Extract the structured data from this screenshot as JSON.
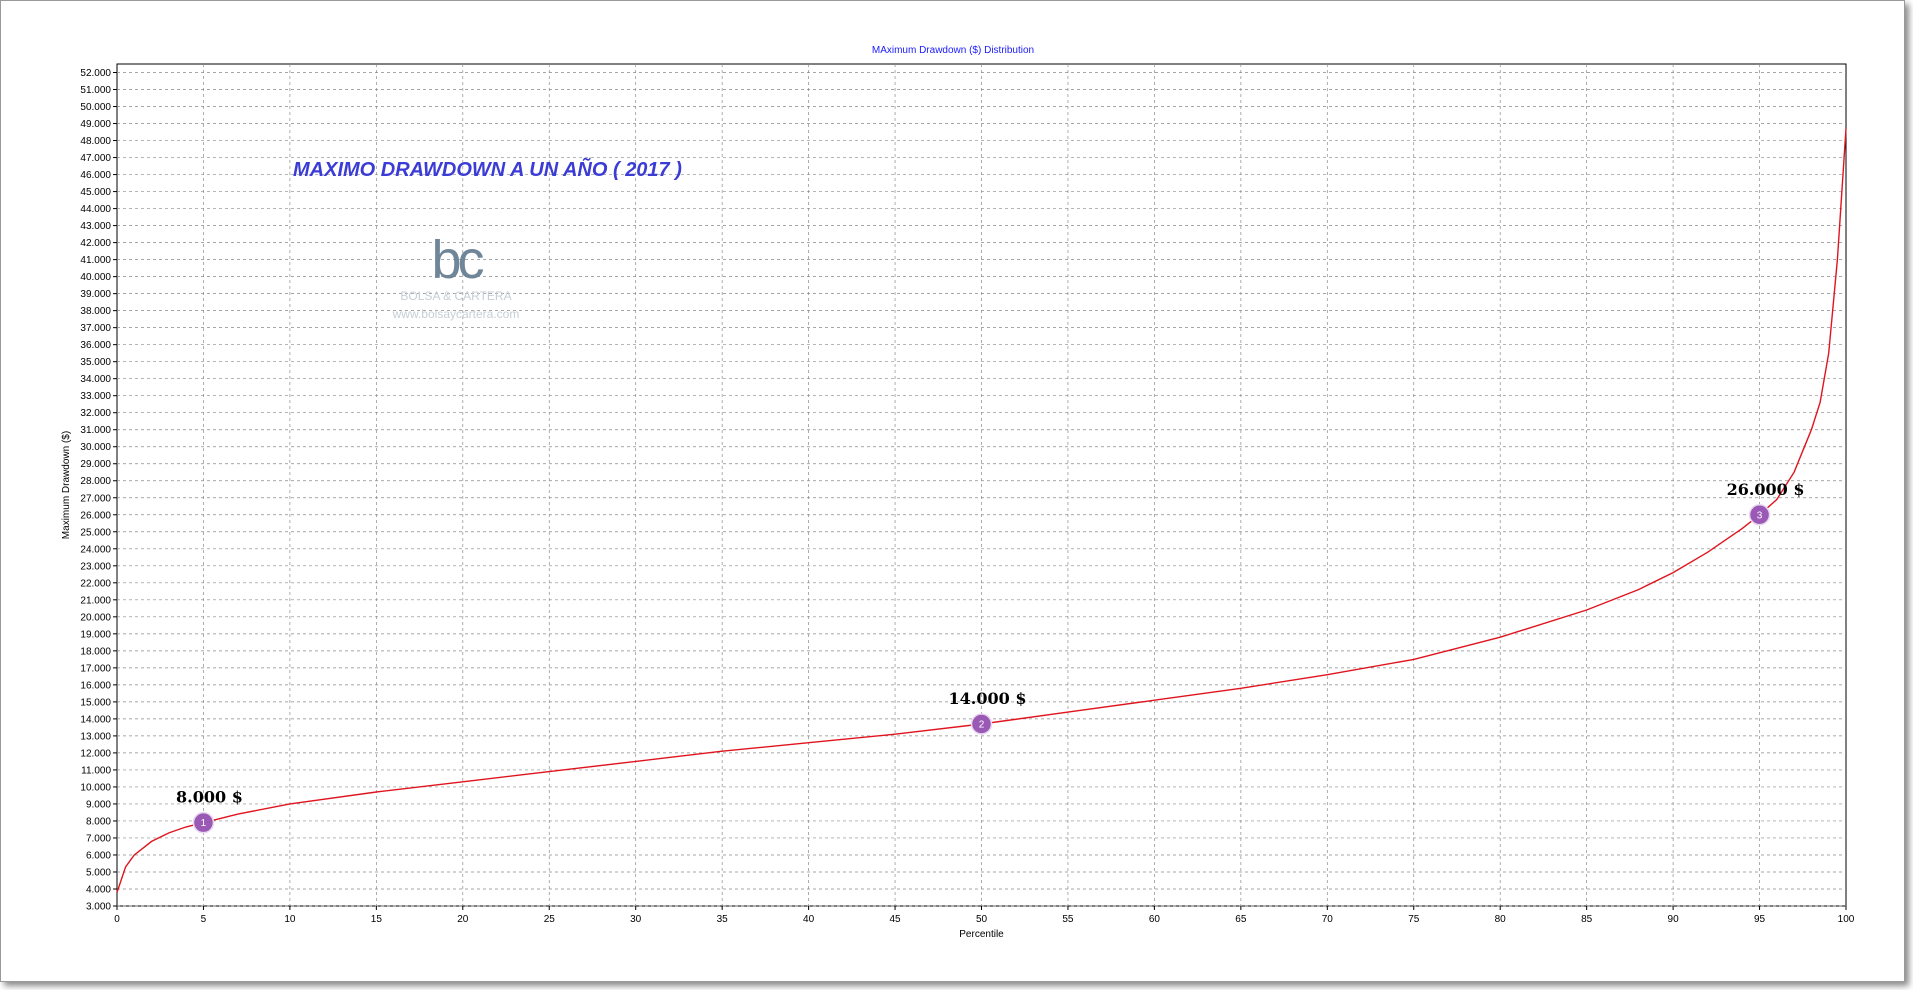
{
  "overlay": {
    "title": "MAXIMO DRAWDOWN A UN AÑO ( 2017 )",
    "logo_mark": "bc",
    "logo_name": "BOLSA & CARTERA",
    "logo_url": "www.bolsaycartera.com"
  },
  "chart_data": {
    "type": "line",
    "title": "MAximum Drawdown ($) Distribution",
    "xlabel": "Percentile",
    "ylabel": "Maximum Drawdown ($)",
    "xlim": [
      0,
      100
    ],
    "ylim": [
      3000,
      53000
    ],
    "x_ticks": [
      0,
      5,
      10,
      15,
      20,
      25,
      30,
      35,
      40,
      45,
      50,
      55,
      60,
      65,
      70,
      75,
      80,
      85,
      90,
      95,
      100
    ],
    "y_ticks": [
      "3.000",
      "4.000",
      "5.000",
      "6.000",
      "7.000",
      "8.000",
      "9.000",
      "10.000",
      "11.000",
      "12.000",
      "13.000",
      "14.000",
      "15.000",
      "16.000",
      "17.000",
      "18.000",
      "19.000",
      "20.000",
      "21.000",
      "22.000",
      "23.000",
      "24.000",
      "25.000",
      "26.000",
      "27.000",
      "28.000",
      "29.000",
      "30.000",
      "31.000",
      "32.000",
      "33.000",
      "34.000",
      "35.000",
      "36.000",
      "37.000",
      "38.000",
      "39.000",
      "40.000",
      "41.000",
      "42.000",
      "43.000",
      "44.000",
      "45.000",
      "46.000",
      "47.000",
      "48.000",
      "49.000",
      "50.000",
      "51.000",
      "52.000"
    ],
    "grid": true,
    "line_color": "#e0141e",
    "marker_color": "#9b59b6",
    "series": [
      {
        "x": [
          0,
          0.5,
          1,
          2,
          3,
          4,
          5,
          7,
          10,
          15,
          20,
          25,
          30,
          35,
          40,
          45,
          50,
          55,
          60,
          65,
          70,
          75,
          80,
          85,
          88,
          90,
          92,
          94,
          95,
          96,
          97,
          98,
          98.5,
          99,
          99.5,
          100
        ],
        "y": [
          3800,
          5300,
          6000,
          6800,
          7300,
          7650,
          7900,
          8400,
          9000,
          9700,
          10300,
          10900,
          11500,
          12100,
          12600,
          13100,
          13700,
          14400,
          15100,
          15800,
          16600,
          17500,
          18800,
          20400,
          21600,
          22600,
          23800,
          25200,
          26000,
          26900,
          28500,
          31000,
          32600,
          35500,
          41000,
          48700
        ]
      }
    ],
    "annotations": [
      {
        "marker": "1",
        "x": 5,
        "y": 7900,
        "label": "8.000 $"
      },
      {
        "marker": "2",
        "x": 50,
        "y": 13700,
        "label": "14.000 $"
      },
      {
        "marker": "3",
        "x": 95,
        "y": 26000,
        "label": "26.000 $"
      }
    ]
  }
}
